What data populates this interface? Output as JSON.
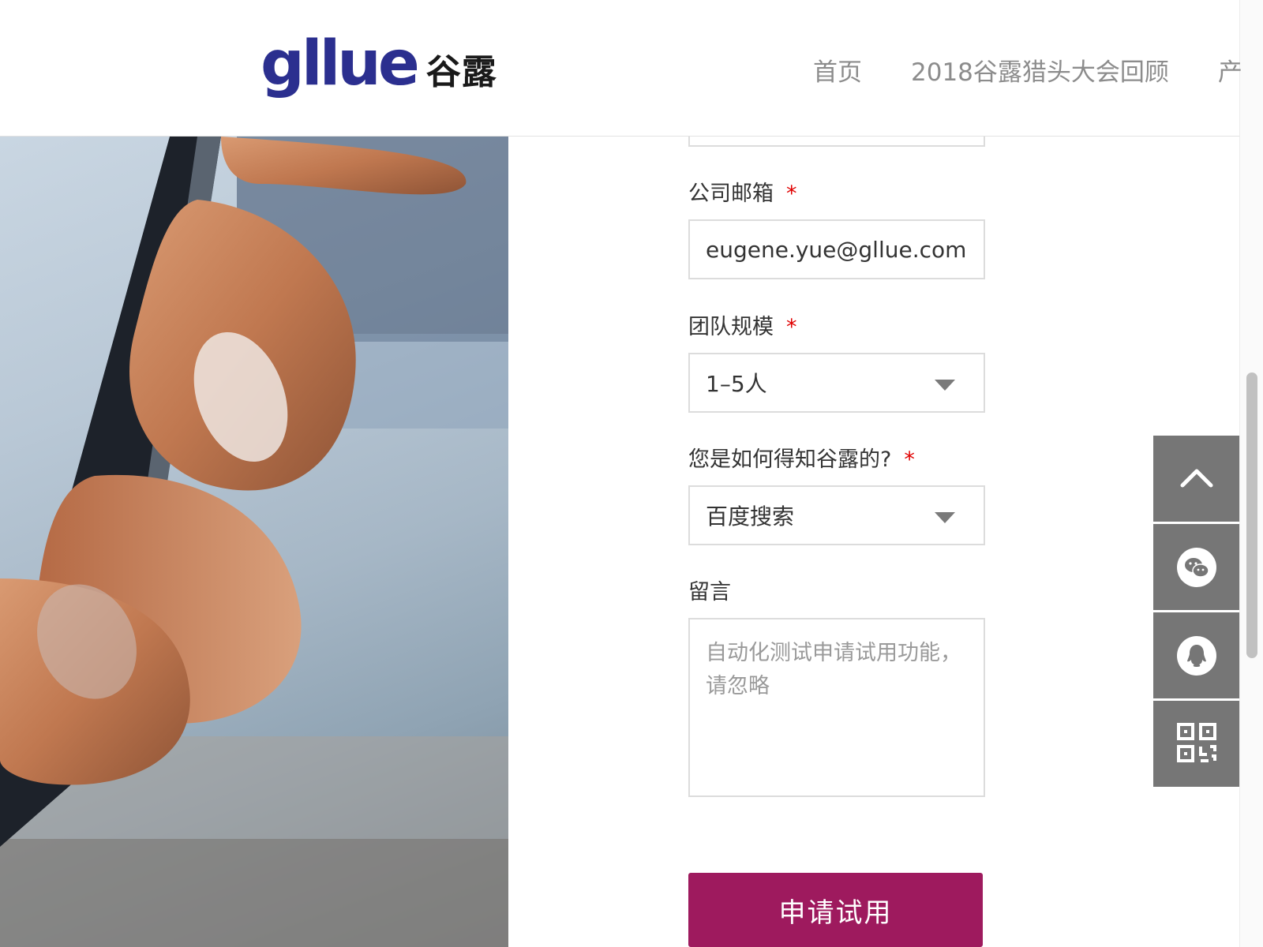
{
  "header": {
    "logo_text": "gllue",
    "logo_cn": "谷露",
    "nav": [
      {
        "label": "首页"
      },
      {
        "label": "2018谷露猎头大会回顾"
      },
      {
        "label": "产"
      }
    ]
  },
  "form": {
    "required_mark": "*",
    "email": {
      "label": "公司邮箱",
      "value": "eugene.yue@gllue.com"
    },
    "team_size": {
      "label": "团队规模",
      "value": "1–5人"
    },
    "source": {
      "label": "您是如何得知谷露的?",
      "value": "百度搜索"
    },
    "message": {
      "label": "留言",
      "value": "自动化测试申请试用功能，请忽略"
    },
    "submit_label": "申请试用"
  },
  "sidebar": {
    "items": [
      {
        "icon": "chevron-up-icon"
      },
      {
        "icon": "wechat-icon"
      },
      {
        "icon": "qq-icon"
      },
      {
        "icon": "qr-code-icon"
      }
    ]
  },
  "colors": {
    "brand_blue": "#2b2f8f",
    "submit_bg": "#9e1a5e",
    "required": "#e00000",
    "sidebar_bg": "#767676"
  }
}
